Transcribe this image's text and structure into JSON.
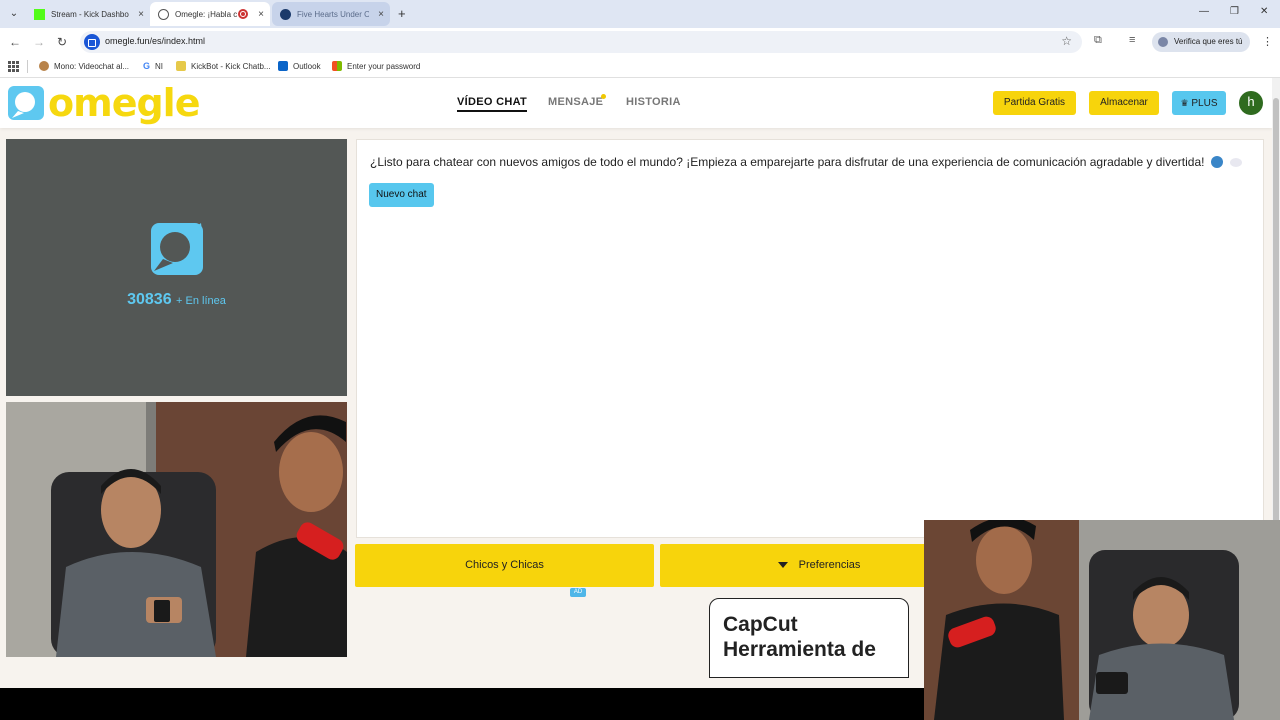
{
  "browser": {
    "tabs": [
      {
        "title": "Stream - Kick Dashbo",
        "favicon": "kick-icon",
        "close": "×"
      },
      {
        "title": "Omegle: ¡Habla c",
        "favicon": "globe-icon",
        "close": "×"
      },
      {
        "title": "Five Hearts Under O",
        "favicon": "steam-icon",
        "close": "×"
      }
    ],
    "new_tab": "+",
    "url": "omegle.fun/es/index.html",
    "verify_label": "Verifica que eres tú",
    "bookmarks": [
      "Mono: Videochat al...",
      "NI",
      "KickBot - Kick Chatb...",
      "Outlook",
      "Enter your password"
    ]
  },
  "site": {
    "logo_text": "omegle",
    "nav": [
      {
        "label": "VÍDEO CHAT"
      },
      {
        "label": "MENSAJE"
      },
      {
        "label": "HISTORIA"
      }
    ],
    "partida_gratis": "Partida Gratis",
    "almacenar": "Almacenar",
    "plus": "PLUS",
    "avatar_letter": "h"
  },
  "stranger": {
    "online_count": "30836",
    "online_label": "+ En línea"
  },
  "chat": {
    "intro": "¿Listo para chatear con nuevos amigos de todo el mundo? ¡Empieza a emparejarte para disfrutar de una experiencia de comunicación agradable y divertida!",
    "new_chat": "Nuevo chat"
  },
  "filters": {
    "gender": "Chicos y Chicas",
    "preferences": "Preferencias"
  },
  "ad": {
    "badge": "AD",
    "title": "CapCut Herramienta de"
  },
  "colors": {
    "brand_yellow": "#f7d40c",
    "brand_blue": "#57c7ee",
    "panel_gray": "#535755"
  }
}
